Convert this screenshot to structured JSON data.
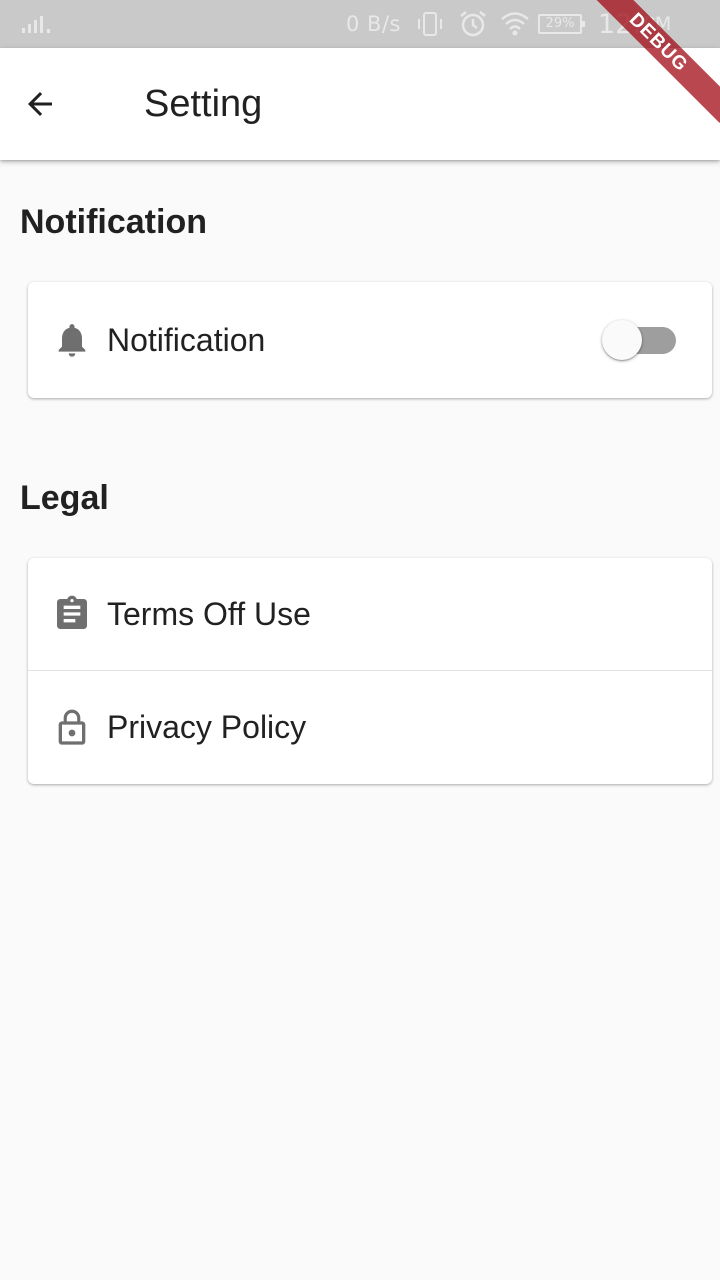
{
  "status_bar": {
    "net_speed": "0 B/s",
    "battery": "29%",
    "time": "12:",
    "ampm": "PM"
  },
  "app_bar": {
    "title": "Setting",
    "back_icon": "arrow-back-icon"
  },
  "debug_banner": {
    "label": "DEBUG"
  },
  "sections": {
    "notification": {
      "header": "Notification",
      "items": [
        {
          "label": "Notification",
          "icon": "bell-icon",
          "toggle_on": false
        }
      ]
    },
    "legal": {
      "header": "Legal",
      "items": [
        {
          "label": "Terms Off Use",
          "icon": "clipboard-icon"
        },
        {
          "label": "Privacy Policy",
          "icon": "lock-icon"
        }
      ]
    }
  },
  "colors": {
    "status_bar": "#c9c9c9",
    "app_bar": "#ffffff",
    "background": "#fafafa",
    "icon": "#6f6f6f",
    "switch_track": "#9e9e9e",
    "debug_ribbon": "#a00a14"
  }
}
